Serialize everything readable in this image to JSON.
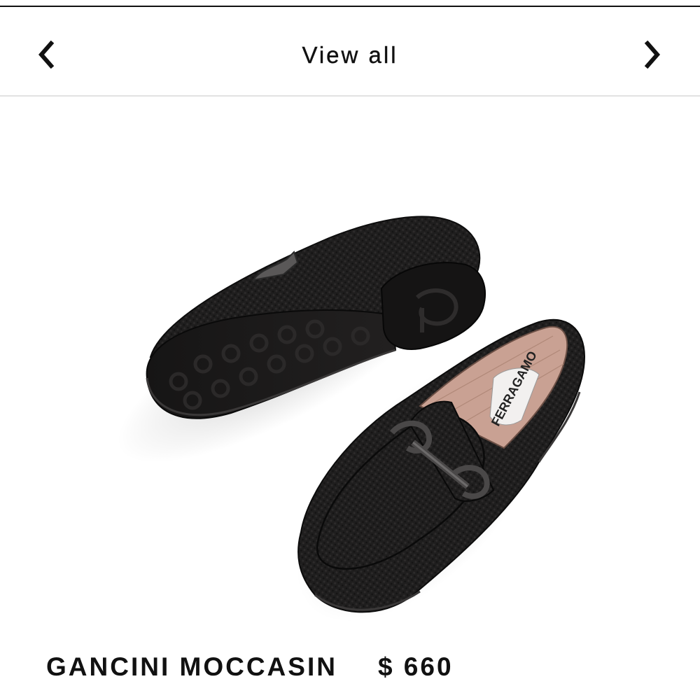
{
  "header": {
    "title": "View all",
    "prev_icon": "chevron-left-icon",
    "next_icon": "chevron-right-icon"
  },
  "product": {
    "name": "GANCINI MOCCASIN",
    "price": "$ 660",
    "image_alt": "Pair of black textured leather moccasins with metal Gancini buckle, one shown from the sole",
    "insole_brand": "FERRAGAMO"
  },
  "colors": {
    "text": "#111111",
    "divider": "#e2e2e2",
    "shoe": "#1c1b1b",
    "lining": "#c9a193"
  }
}
